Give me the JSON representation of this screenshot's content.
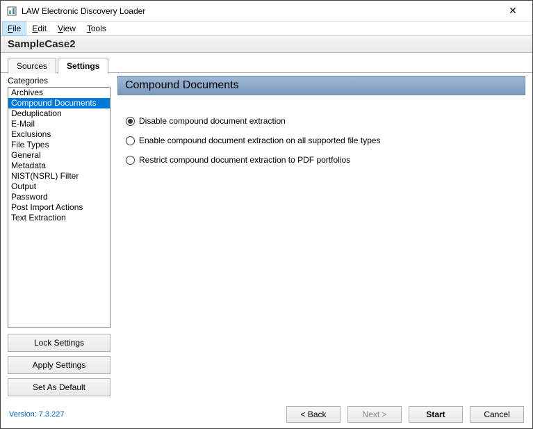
{
  "window": {
    "title": "LAW Electronic Discovery Loader"
  },
  "menu": {
    "file": "File",
    "edit": "Edit",
    "view": "View",
    "tools": "Tools",
    "active": "file"
  },
  "case": {
    "title": "SampleCase2"
  },
  "tabs": {
    "sources": "Sources",
    "settings": "Settings",
    "active": "settings"
  },
  "sidebar": {
    "label": "Categories",
    "items": [
      "Archives",
      "Compound Documents",
      "Deduplication",
      "E-Mail",
      "Exclusions",
      "File Types",
      "General",
      "Metadata",
      "NIST(NSRL) Filter",
      "Output",
      "Password",
      "Post Import Actions",
      "Text Extraction"
    ],
    "selected": "Compound Documents",
    "buttons": {
      "lock": "Lock Settings",
      "apply": "Apply Settings",
      "default": "Set As Default"
    }
  },
  "panel": {
    "title": "Compound Documents",
    "options": [
      "Disable compound document extraction",
      "Enable compound document extraction on all supported file types",
      "Restrict compound document extraction to PDF portfolios"
    ],
    "selected_index": 0
  },
  "footer": {
    "version": "Version: 7.3.227",
    "back": "< Back",
    "next": "Next >",
    "start": "Start",
    "cancel": "Cancel"
  }
}
